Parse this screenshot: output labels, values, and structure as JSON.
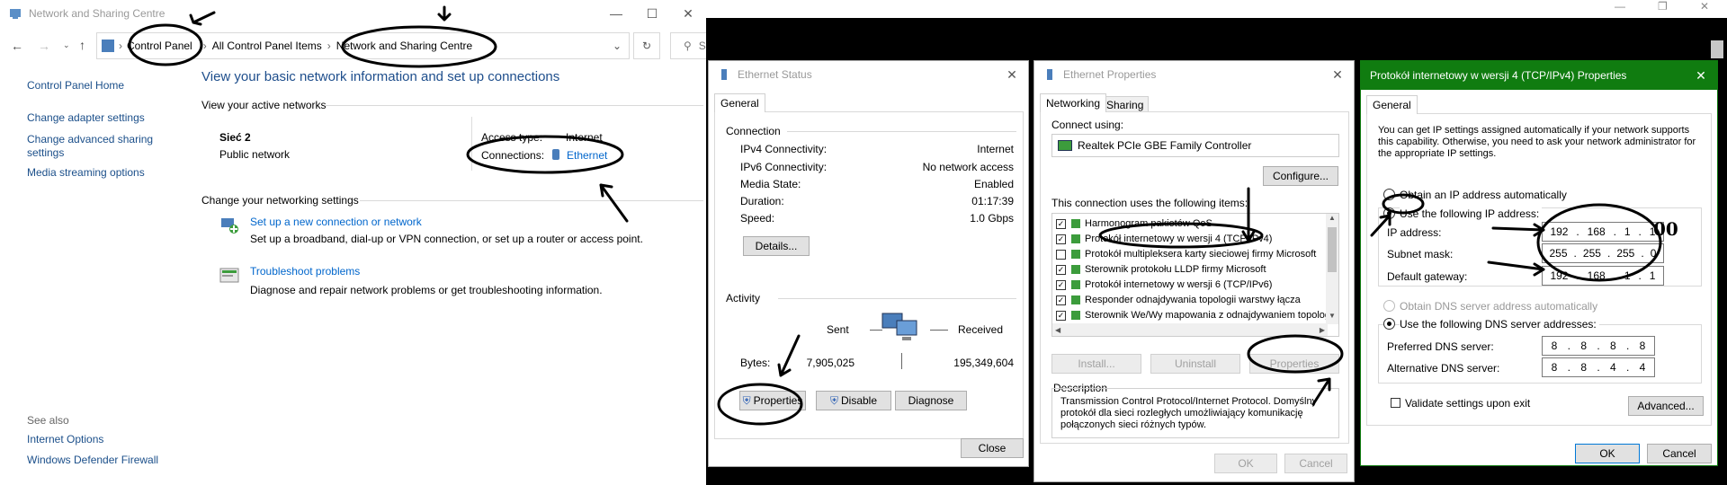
{
  "network_window": {
    "title": "Network and Sharing Centre",
    "breadcrumb": [
      "Control Panel",
      "All Control Panel Items",
      "Network and Sharing Centre"
    ],
    "search_placeholder": "Search Control Panel",
    "sidebar": {
      "home": "Control Panel Home",
      "items": [
        "Change adapter settings",
        "Change advanced sharing settings",
        "Media streaming options"
      ],
      "see_also": "See also",
      "see_also_items": [
        "Internet Options",
        "Windows Defender Firewall"
      ]
    },
    "heading": "View your basic network information and set up connections",
    "active_networks_label": "View your active networks",
    "network_name": "Sieć 2",
    "network_type": "Public network",
    "access_type_label": "Access type:",
    "access_type_value": "Internet",
    "connections_label": "Connections:",
    "connections_value": "Ethernet",
    "change_settings_label": "Change your networking settings",
    "tasks": [
      {
        "title": "Set up a new connection or network",
        "desc": "Set up a broadband, dial-up or VPN connection, or set up a router or access point."
      },
      {
        "title": "Troubleshoot problems",
        "desc": "Diagnose and repair network problems or get troubleshooting information."
      }
    ]
  },
  "status_window": {
    "title": "Ethernet Status",
    "tab": "General",
    "connection_label": "Connection",
    "rows": [
      {
        "label": "IPv4 Connectivity:",
        "value": "Internet"
      },
      {
        "label": "IPv6 Connectivity:",
        "value": "No network access"
      },
      {
        "label": "Media State:",
        "value": "Enabled"
      },
      {
        "label": "Duration:",
        "value": "01:17:39"
      },
      {
        "label": "Speed:",
        "value": "1.0 Gbps"
      }
    ],
    "details_button": "Details...",
    "activity_label": "Activity",
    "sent_label": "Sent",
    "received_label": "Received",
    "bytes_label": "Bytes:",
    "bytes_sent": "7,905,025",
    "bytes_received": "195,349,604",
    "properties_button": "Properties",
    "disable_button": "Disable",
    "diagnose_button": "Diagnose",
    "close_button": "Close"
  },
  "properties_window": {
    "title": "Ethernet Properties",
    "tabs": [
      "Networking",
      "Sharing"
    ],
    "connect_using_label": "Connect using:",
    "adapter": "Realtek PCIe GBE Family Controller",
    "configure_button": "Configure...",
    "items_label": "This connection uses the following items:",
    "items": [
      {
        "label": "Harmonogram pakietów QoS",
        "checked": true
      },
      {
        "label": "Protokół internetowy w wersji 4 (TCP/IPv4)",
        "checked": true
      },
      {
        "label": "Protokół multipleksera karty sieciowej firmy Microsoft",
        "checked": false
      },
      {
        "label": "Sterownik protokołu LLDP firmy Microsoft",
        "checked": true
      },
      {
        "label": "Protokół internetowy w wersji 6 (TCP/IPv6)",
        "checked": true
      },
      {
        "label": "Responder odnajdywania topologii warstwy łącza",
        "checked": true
      },
      {
        "label": "Sterownik We/Wy mapowania z odnajdywaniem topologii",
        "checked": true
      }
    ],
    "install_button": "Install...",
    "uninstall_button": "Uninstall",
    "properties_button": "Properties",
    "description_label": "Description",
    "description": "Transmission Control Protocol/Internet Protocol. Domyślny protokół dla sieci rozległych umożliwiający komunikację połączonych sieci różnych typów.",
    "ok_button": "OK",
    "cancel_button": "Cancel"
  },
  "ipv4_window": {
    "title": "Protokół internetowy w wersji 4 (TCP/IPv4) Properties",
    "tab": "General",
    "intro": "You can get IP settings assigned automatically if your network supports this capability. Otherwise, you need to ask your network administrator for the appropriate IP settings.",
    "auto_ip": "Obtain an IP address automatically",
    "manual_ip": "Use the following IP address:",
    "ip_label": "IP address:",
    "ip_value": [
      "192",
      "168",
      "1",
      "1"
    ],
    "ip_annotation": "00",
    "mask_label": "Subnet mask:",
    "mask_value": [
      "255",
      "255",
      "255",
      "0"
    ],
    "gateway_label": "Default gateway:",
    "gateway_value": [
      "192",
      "168",
      "1",
      "1"
    ],
    "auto_dns": "Obtain DNS server address automatically",
    "manual_dns": "Use the following DNS server addresses:",
    "preferred_dns_label": "Preferred DNS server:",
    "preferred_dns_value": [
      "8",
      "8",
      "8",
      "8"
    ],
    "alt_dns_label": "Alternative DNS server:",
    "alt_dns_value": [
      "8",
      "8",
      "4",
      "4"
    ],
    "validate_label": "Validate settings upon exit",
    "advanced_button": "Advanced...",
    "ok_button": "OK",
    "cancel_button": "Cancel",
    "accent_color": "#107c10"
  }
}
